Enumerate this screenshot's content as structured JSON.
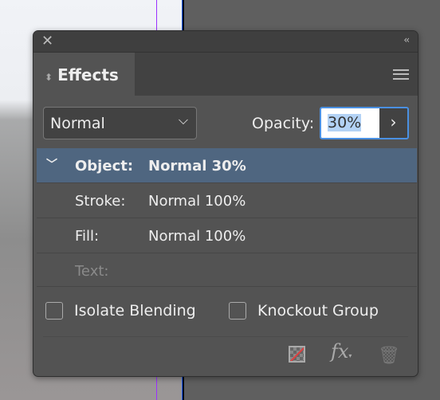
{
  "panel": {
    "title": "Effects",
    "close_icon": "close-icon",
    "collapse_icon": "double-chevron-left-icon",
    "menu_icon": "hamburger-menu-icon"
  },
  "controls": {
    "blend_mode": "Normal",
    "opacity_label": "Opacity:",
    "opacity_value": "30%"
  },
  "rows": [
    {
      "key": "Object:",
      "value": "Normal 30%",
      "selected": true
    },
    {
      "key": "Stroke:",
      "value": "Normal 100%"
    },
    {
      "key": "Fill:",
      "value": "Normal 100%"
    },
    {
      "key": "Text:",
      "value": "",
      "disabled": true
    }
  ],
  "options": {
    "isolate_blending": "Isolate Blending",
    "isolate_checked": false,
    "knockout_group": "Knockout Group",
    "knockout_checked": false
  },
  "footer": {
    "clear_effects_icon": "clear-transparency-icon",
    "fx_icon": "fx-icon",
    "fx_label": "fx",
    "delete_icon": "trash-icon"
  },
  "colors": {
    "selected_row": "#4f6680",
    "focus": "#4a90e2"
  }
}
